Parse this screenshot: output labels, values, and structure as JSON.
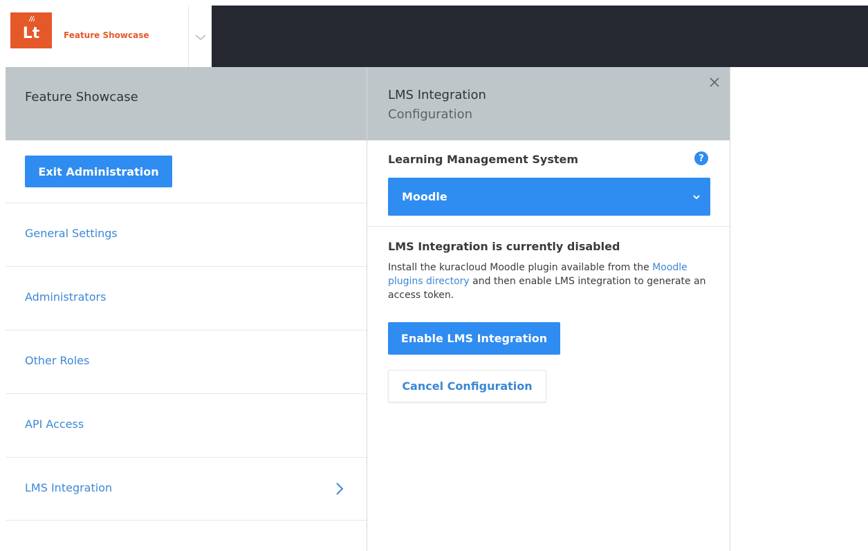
{
  "brand": {
    "logo_text": "Lt",
    "name": "Feature Showcase",
    "accent_color": "#e4582a"
  },
  "sidebar": {
    "title": "Feature Showcase",
    "exit_button": "Exit Administration",
    "items": [
      {
        "label": "General Settings",
        "icon": ""
      },
      {
        "label": "Administrators",
        "icon": ""
      },
      {
        "label": "Other Roles",
        "icon": ""
      },
      {
        "label": "API Access",
        "icon": ""
      },
      {
        "label": "LMS Integration",
        "icon": "chevron-right-icon"
      }
    ]
  },
  "panel": {
    "title": "LMS Integration",
    "subtitle": "Configuration",
    "system_label": "Learning Management System",
    "help_icon": "?",
    "selected_system": "Moodle",
    "status_title": "LMS Integration is currently disabled",
    "status_desc_before": "Install the kuracloud Moodle plugin available from the ",
    "status_desc_link": "Moodle plugins directory",
    "status_desc_after": " and then enable LMS integration to generate an access token.",
    "enable_button": "Enable LMS Integration",
    "cancel_button": "Cancel Configuration"
  },
  "colors": {
    "primary": "#2f8cf0",
    "link": "#3c87d6",
    "header_bg": "#bfc6ca",
    "topbar_dark": "#252830"
  }
}
